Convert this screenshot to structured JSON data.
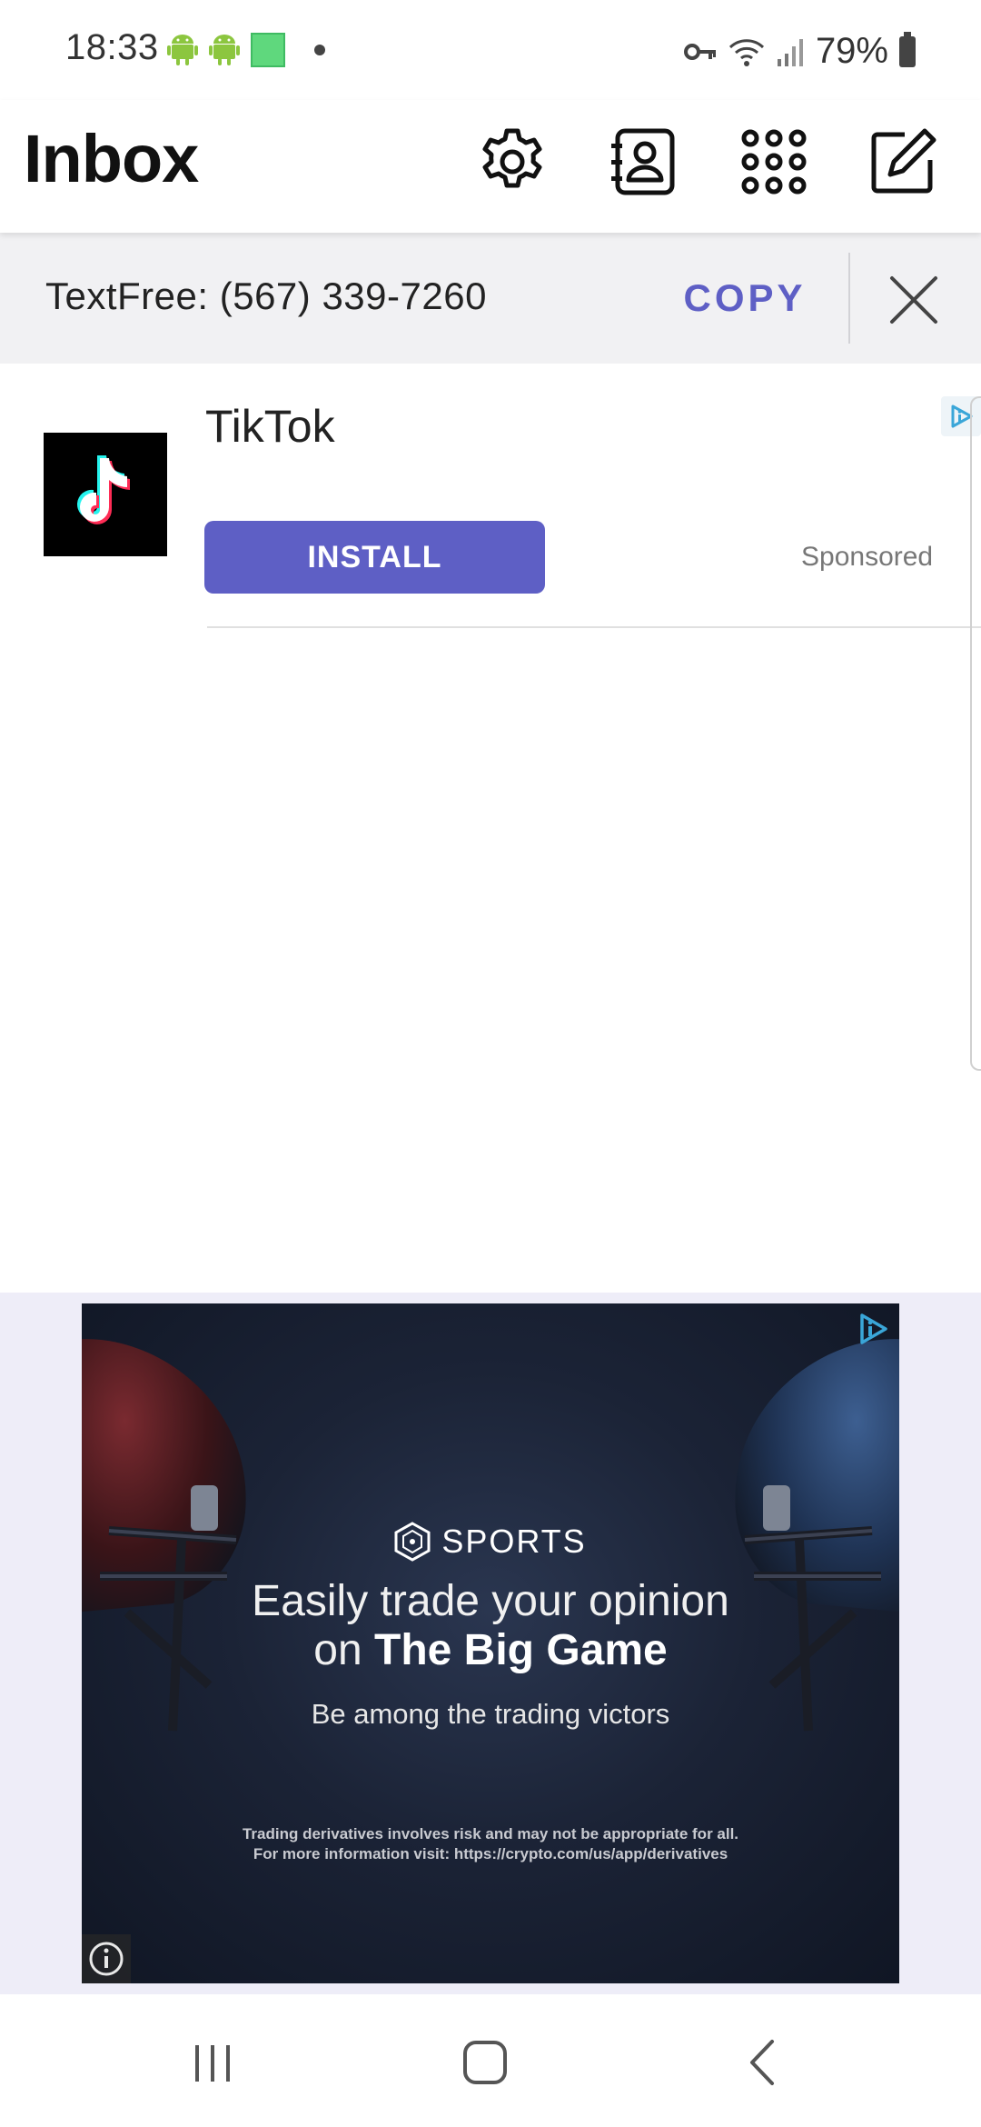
{
  "status_bar": {
    "time": "18:33",
    "battery": "79%",
    "icons_left": [
      "android-icon",
      "android-icon",
      "green-square-icon",
      "dot-icon"
    ],
    "icons_right": [
      "key-icon",
      "wifi-icon",
      "signal-icon",
      "battery-icon"
    ]
  },
  "header": {
    "title": "Inbox",
    "icons": [
      "gear-icon",
      "contacts-icon",
      "dialpad-icon",
      "compose-icon"
    ]
  },
  "number_banner": {
    "text": "TextFree: (567) 339-7260",
    "copy_label": "COPY",
    "close_icon": "close-icon"
  },
  "native_ad": {
    "app_name": "TikTok",
    "install_label": "INSTALL",
    "sponsored_label": "Sponsored",
    "accent_color": "#5e5fc5"
  },
  "banner_ad": {
    "brand_label": "SPORTS",
    "headline_line1": "Easily trade your opinion",
    "headline_line2_prefix": "on ",
    "headline_line2_bold": "The Big Game",
    "subline": "Be among the trading victors",
    "disclaimer_line1": "Trading derivatives involves risk and may not be appropriate for all.",
    "disclaimer_line2": "For more information visit: https://crypto.com/us/app/derivatives"
  },
  "nav_bar": {
    "buttons": [
      "recents-icon",
      "home-icon",
      "back-icon"
    ]
  }
}
